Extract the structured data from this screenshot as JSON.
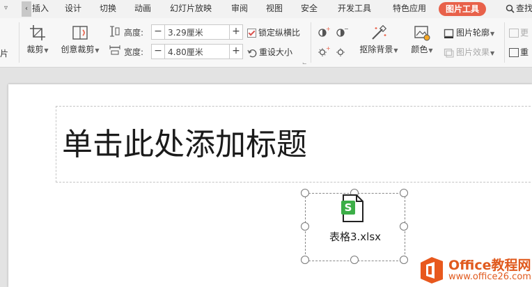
{
  "menu": {
    "tabs": [
      "插入",
      "设计",
      "切换",
      "动画",
      "幻灯片放映",
      "审阅",
      "视图",
      "安全",
      "开发工具",
      "特色应用"
    ],
    "active_tab": "图片工具",
    "search_label": "查找"
  },
  "ribbon": {
    "left_cut_label": "片",
    "crop_label": "裁剪",
    "creative_crop_label": "创意裁剪",
    "height_label": "高度:",
    "height_value": "3.29厘米",
    "width_label": "宽度:",
    "width_value": "4.80厘米",
    "lock_ratio_label": "锁定纵横比",
    "reset_size_label": "重设大小",
    "remove_bg_label": "抠除背景",
    "color_label": "颜色",
    "outline_label": "图片轮廓",
    "effects_label": "图片效果",
    "right_cut_top": "更",
    "right_cut_bottom": "重"
  },
  "slide": {
    "title_placeholder": "单击此处添加标题",
    "embedded_file_name": "表格3.xlsx",
    "file_icon_letter": "S"
  },
  "watermark": {
    "title": "Office教程网",
    "url": "www.office26.com"
  },
  "colors": {
    "active_tab_bg": "#e8614a",
    "watermark_orange": "#e05a1e",
    "sheet_icon_green": "#3cae47"
  }
}
